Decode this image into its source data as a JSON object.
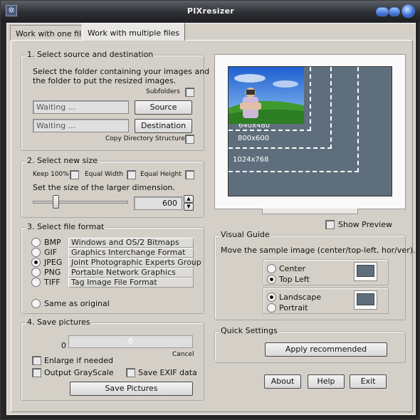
{
  "window": {
    "title": "PIXresizer"
  },
  "tabs": [
    {
      "label": "Work with one file"
    },
    {
      "label": "Work with multiple files"
    }
  ],
  "source": {
    "title": "1. Select source and destination",
    "instructions_line1": "Select the folder containing your images and",
    "instructions_line2": "the folder to put the resized images.",
    "subfolders_label": "Subfolders",
    "source_value": "Waiting ...",
    "source_button": "Source",
    "dest_value": "Waiting ...",
    "dest_button": "Destination",
    "copy_dir_label": "Copy Directory Structure"
  },
  "size": {
    "title": "2. Select new size",
    "keep_label": "Keep 100%",
    "equal_width_label": "Equal Width",
    "equal_height_label": "Equal Height",
    "instruction": "Set the size of the larger dimension.",
    "value": "600",
    "slider_fraction": 0.22
  },
  "format": {
    "title": "3. Select file format",
    "options": [
      {
        "name": "BMP",
        "desc": "Windows and OS/2 Bitmaps",
        "selected": false
      },
      {
        "name": "GIF",
        "desc": "Graphics Interchange Format",
        "selected": false
      },
      {
        "name": "JPEG",
        "desc": "Joint Photographic Experts Group",
        "selected": true
      },
      {
        "name": "PNG",
        "desc": "Portable Network Graphics",
        "selected": false
      },
      {
        "name": "TIFF",
        "desc": "Tag Image File Format",
        "selected": false
      }
    ],
    "same_as_original": "Same as original"
  },
  "save": {
    "title": "4. Save pictures",
    "count": "0",
    "progress_text": "0",
    "cancel_label": "Cancel",
    "enlarge_label": "Enlarge if needed",
    "grayscale_label": "Output GrayScale",
    "exif_label": "Save EXIF data",
    "save_button": "Save Pictures"
  },
  "preview": {
    "guide_640": "640x480",
    "guide_800": "800x600",
    "guide_1024": "1024x768",
    "show_preview_label": "Show Preview",
    "screen_color": "#5e6e7c"
  },
  "visual_guide": {
    "title": "Visual Guide",
    "instruction": "Move the sample image (center/top-left, hor/ver).",
    "center_label": "Center",
    "topleft_label": "Top Left",
    "landscape_label": "Landscape",
    "portrait_label": "Portrait"
  },
  "quick": {
    "title": "Quick Settings",
    "apply_button": "Apply recommended"
  },
  "footer": {
    "about_button": "About",
    "help_button": "Help",
    "exit_button": "Exit"
  }
}
